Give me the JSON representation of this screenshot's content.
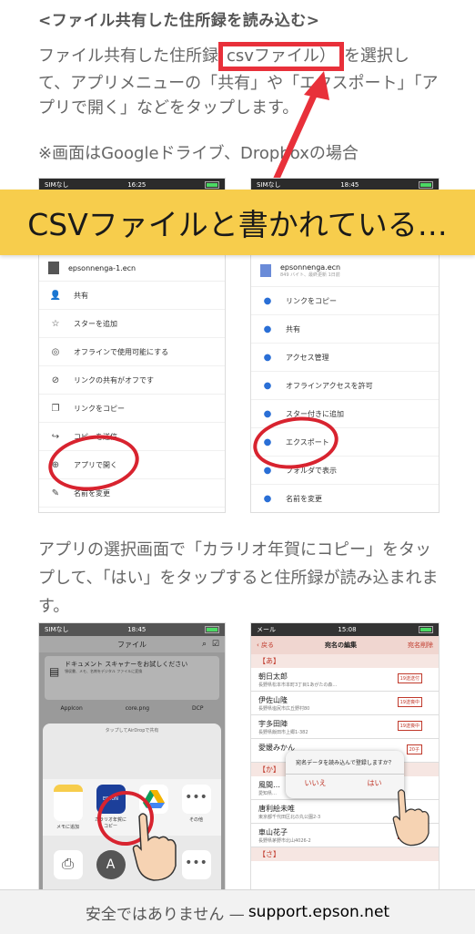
{
  "heading": "<ファイル共有した住所録を読み込む>",
  "para1": {
    "before": "ファイル共有した住所録",
    "highlight": "csvファイル）",
    "after": "を選択して、アプリメニューの「共有」や「エクスポート」「アプリで開く」などをタップします。",
    "note": "※画面はGoogleドライブ、Dropboxの場合"
  },
  "banner": "CSVファイルと書かれている…",
  "phone_left": {
    "carrier": "SIMなし",
    "time": "16:25",
    "filename": "epsonnenga-1.ecn",
    "menu": [
      "共有",
      "スターを追加",
      "オフラインで使用可能にする",
      "リンクの共有がオフです",
      "リンクをコピー",
      "コピーを送信",
      "アプリで開く",
      "名前を変更"
    ],
    "icons": [
      "person-plus-icon",
      "star-icon",
      "offline-icon",
      "link-off-icon",
      "copy-icon",
      "forward-icon",
      "open-app-icon",
      "pencil-icon"
    ]
  },
  "phone_right": {
    "carrier": "SIMなし",
    "time": "18:45",
    "filename": "epsonnenga.ecn",
    "filemeta": "849 バイト、最終更新 1日前",
    "menu": [
      "リンクをコピー",
      "共有",
      "アクセス管理",
      "オフラインアクセスを許可",
      "スター付きに追加",
      "エクスポート",
      "フォルダで表示",
      "名前を変更"
    ]
  },
  "para2": "アプリの選択画面で「カラリオ年賀にコピー」をタップして、「はい」をタップすると住所録が読み込まれます。",
  "phone_bl": {
    "carrier": "SIMなし",
    "time": "18:45",
    "title": "ファイル",
    "scanner_title": "ドキュメント スキャナーをお試しください",
    "scanner_sub": "領収書、メモ、名刺をデジタル ファイルに変換",
    "files": [
      "AppIcon",
      "core.png",
      "DCP"
    ],
    "airdrop": "タップしてAirDropで共有",
    "apps": [
      "メモに追加",
      "カラリオ年賀にコピー",
      "",
      "その他"
    ],
    "epson_label": "EPSON"
  },
  "phone_br": {
    "carrier": "メール",
    "time": "15:08",
    "back": "戻る",
    "title": "宛名の編集",
    "action": "宛名削除",
    "sec_a": "【あ】",
    "sec_ka": "【か】",
    "sec_sa": "【さ】",
    "rows": [
      {
        "name": "朝日太郎",
        "addr": "長野県松本市本町3丁目1あがたの森…",
        "tag": "19送送付"
      },
      {
        "name": "伊佐山隆",
        "addr": "長野県塩尻市広丘野村80",
        "tag": "19送喪中"
      },
      {
        "name": "宇多田陣",
        "addr": "長野県飯田市上郷1-382",
        "tag": "19送喪中"
      },
      {
        "name": "愛媛みかん",
        "addr": "",
        "tag": "20子"
      }
    ],
    "rows2": [
      {
        "name": "風間…",
        "addr": "愛知県…"
      },
      {
        "name": "唐利絵未唯",
        "addr": "東京都千代田区北の丸公園2-3"
      },
      {
        "name": "車山花子",
        "addr": "長野県茅野市北山4026-2",
        "tag": "20子送付"
      }
    ],
    "dialog_msg": "宛名データを読み込んで登録しますか？",
    "dialog_no": "いいえ",
    "dialog_yes": "はい"
  },
  "urlbar": {
    "warning": "安全ではありません —",
    "domain": "support.epson.net"
  },
  "colors": {
    "accent_red": "#e8303a",
    "banner_yellow": "#f7cd4c"
  }
}
